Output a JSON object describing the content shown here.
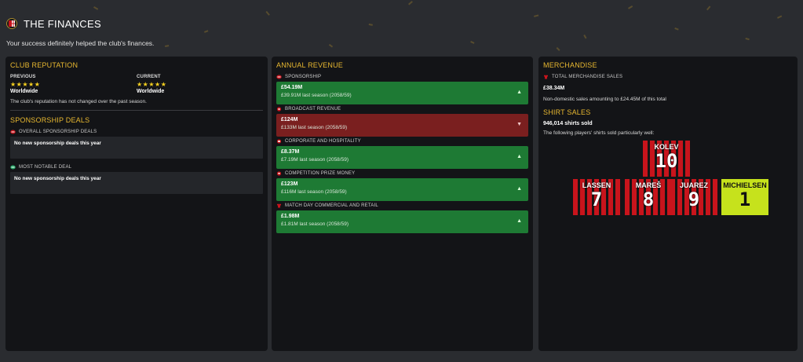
{
  "header": {
    "title": "THE FINANCES",
    "subtitle": "Your success definitely helped the club's finances."
  },
  "colors": {
    "accent": "#e8b830",
    "revenue_up": "#1e7a34",
    "revenue_down": "#7a1f1f",
    "panel": "#131417",
    "shirt_red": "#c8141c",
    "keeper_yellow": "#c6e21c"
  },
  "reputation": {
    "title": "CLUB REPUTATION",
    "previous_label": "PREVIOUS",
    "previous_stars": 5,
    "previous_stars_text": "★★★★★",
    "previous_value": "Worldwide",
    "current_label": "CURRENT",
    "current_stars": 5,
    "current_stars_text": "★★★★★",
    "current_value": "Worldwide",
    "note": "The club's reputation has not changed over the past season."
  },
  "sponsorship": {
    "title": "SPONSORSHIP DEALS",
    "overall_label": "OVERALL SPONSORSHIP DEALS",
    "overall_value": "No new sponsorship deals this year",
    "notable_label": "MOST NOTABLE DEAL",
    "notable_value": "No new sponsorship deals this year"
  },
  "revenue": {
    "title": "ANNUAL REVENUE",
    "items": [
      {
        "label": "SPONSORSHIP",
        "value": "£54.19M",
        "last": "£39.91M last season (2058/59)",
        "trend": "up",
        "arrow": "▲"
      },
      {
        "label": "BROADCAST REVENUE",
        "value": "£124M",
        "last": "£133M last season (2058/59)",
        "trend": "down",
        "arrow": "▼"
      },
      {
        "label": "CORPORATE AND HOSPITALITY",
        "value": "£8.37M",
        "last": "£7.19M last season (2058/59)",
        "trend": "up",
        "arrow": "▲"
      },
      {
        "label": "COMPETITION PRIZE MONEY",
        "value": "£123M",
        "last": "£116M last season (2058/59)",
        "trend": "up",
        "arrow": "▲"
      },
      {
        "label": "MATCH DAY COMMERCIAL AND RETAIL",
        "value": "£1.98M",
        "last": "£1.81M last season (2058/59)",
        "trend": "up",
        "arrow": "▲"
      }
    ]
  },
  "merchandise": {
    "title": "MERCHANDISE",
    "total_label": "TOTAL MERCHANDISE SALES",
    "total_value": "£38.34M",
    "note": "Non-domestic sales amounting to £24.45M of this total"
  },
  "shirt_sales": {
    "title": "SHIRT SALES",
    "count": "946,014 shirts sold",
    "note": "The following players' shirts sold particularly well:",
    "shirts": [
      {
        "name": "KOLEV",
        "number": "10",
        "keeper": false
      },
      {
        "name": "LASSEN",
        "number": "7",
        "keeper": false
      },
      {
        "name": "MAREŠ",
        "number": "8",
        "keeper": false
      },
      {
        "name": "JUAREZ",
        "number": "9",
        "keeper": false
      },
      {
        "name": "MICHIELSEN",
        "number": "1",
        "keeper": true
      }
    ]
  }
}
